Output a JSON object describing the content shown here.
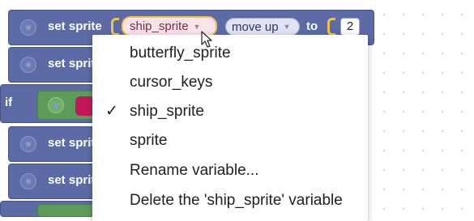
{
  "blocks": {
    "set_sprite_label": "set sprite",
    "set_sprite_truncated": "set sprit",
    "if_label": "if",
    "variable_value": "ship_sprite",
    "direction_value": "move up",
    "to_label": "to",
    "number_value": "2"
  },
  "menu": {
    "items": [
      {
        "label": "butterfly_sprite",
        "checked": false
      },
      {
        "label": "cursor_keys",
        "checked": false
      },
      {
        "label": "ship_sprite",
        "checked": true
      },
      {
        "label": "sprite",
        "checked": false
      },
      {
        "label": "Rename variable...",
        "checked": false
      },
      {
        "label": "Delete the 'ship_sprite' variable",
        "checked": false
      }
    ],
    "check_mark": "✓"
  },
  "colors": {
    "block": "#5c6aa6",
    "if_block": "#5c9c58",
    "variable_pill": "#fbe3ea",
    "highlight": "#f1c24a"
  },
  "icons": [
    "gear-icon",
    "dropdown-caret-icon",
    "mouse-cursor-icon",
    "checkmark-icon"
  ]
}
